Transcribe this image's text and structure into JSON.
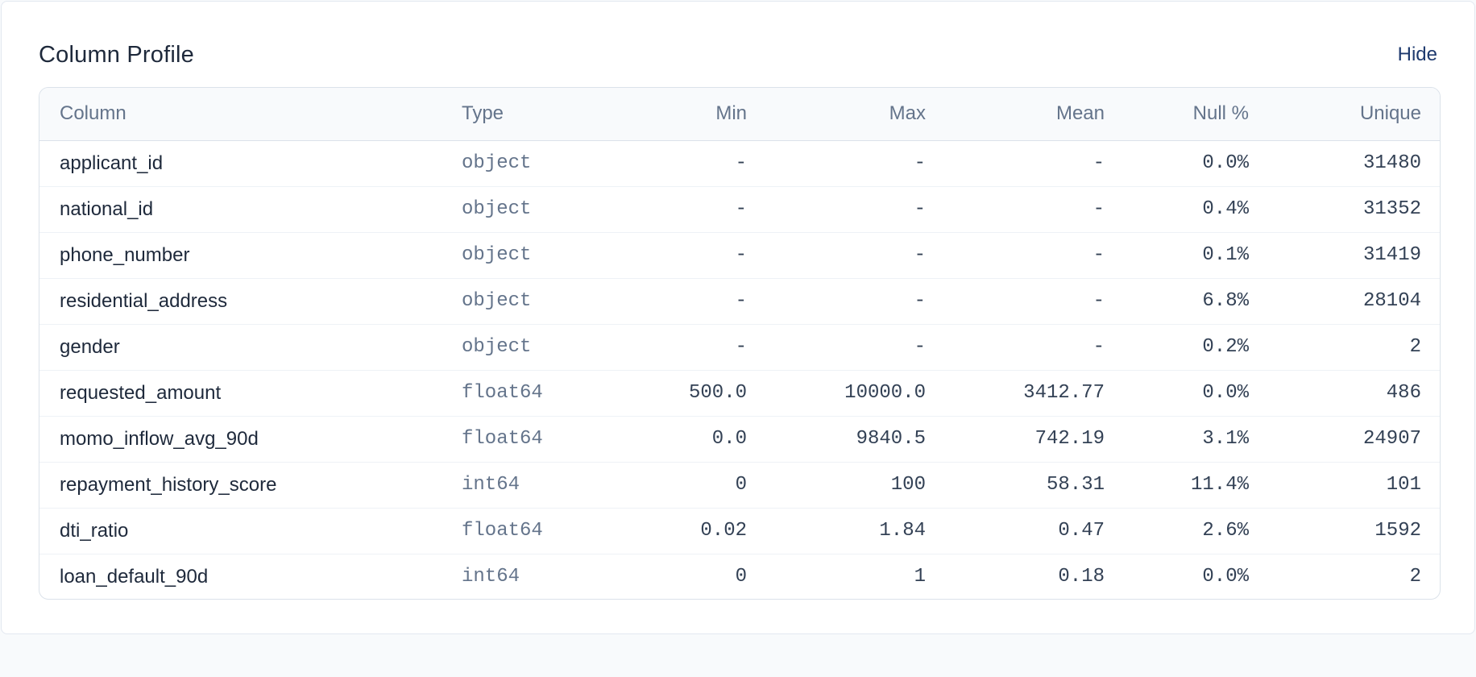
{
  "panel": {
    "title": "Column Profile",
    "hide_label": "Hide"
  },
  "table": {
    "headers": {
      "column": "Column",
      "type": "Type",
      "min": "Min",
      "max": "Max",
      "mean": "Mean",
      "null_pct": "Null %",
      "unique": "Unique"
    },
    "rows": [
      {
        "column": "applicant_id",
        "type": "object",
        "min": "-",
        "max": "-",
        "mean": "-",
        "null_pct": "0.0%",
        "unique": "31480"
      },
      {
        "column": "national_id",
        "type": "object",
        "min": "-",
        "max": "-",
        "mean": "-",
        "null_pct": "0.4%",
        "unique": "31352"
      },
      {
        "column": "phone_number",
        "type": "object",
        "min": "-",
        "max": "-",
        "mean": "-",
        "null_pct": "0.1%",
        "unique": "31419"
      },
      {
        "column": "residential_address",
        "type": "object",
        "min": "-",
        "max": "-",
        "mean": "-",
        "null_pct": "6.8%",
        "unique": "28104"
      },
      {
        "column": "gender",
        "type": "object",
        "min": "-",
        "max": "-",
        "mean": "-",
        "null_pct": "0.2%",
        "unique": "2"
      },
      {
        "column": "requested_amount",
        "type": "float64",
        "min": "500.0",
        "max": "10000.0",
        "mean": "3412.77",
        "null_pct": "0.0%",
        "unique": "486"
      },
      {
        "column": "momo_inflow_avg_90d",
        "type": "float64",
        "min": "0.0",
        "max": "9840.5",
        "mean": "742.19",
        "null_pct": "3.1%",
        "unique": "24907"
      },
      {
        "column": "repayment_history_score",
        "type": "int64",
        "min": "0",
        "max": "100",
        "mean": "58.31",
        "null_pct": "11.4%",
        "unique": "101"
      },
      {
        "column": "dti_ratio",
        "type": "float64",
        "min": "0.02",
        "max": "1.84",
        "mean": "0.47",
        "null_pct": "2.6%",
        "unique": "1592"
      },
      {
        "column": "loan_default_90d",
        "type": "int64",
        "min": "0",
        "max": "1",
        "mean": "0.18",
        "null_pct": "0.0%",
        "unique": "2"
      }
    ]
  },
  "colors": {
    "accent": "#1e3a6e",
    "header_text": "#64748b",
    "border": "#dbe2ea",
    "page_bg": "#f8fafc"
  }
}
